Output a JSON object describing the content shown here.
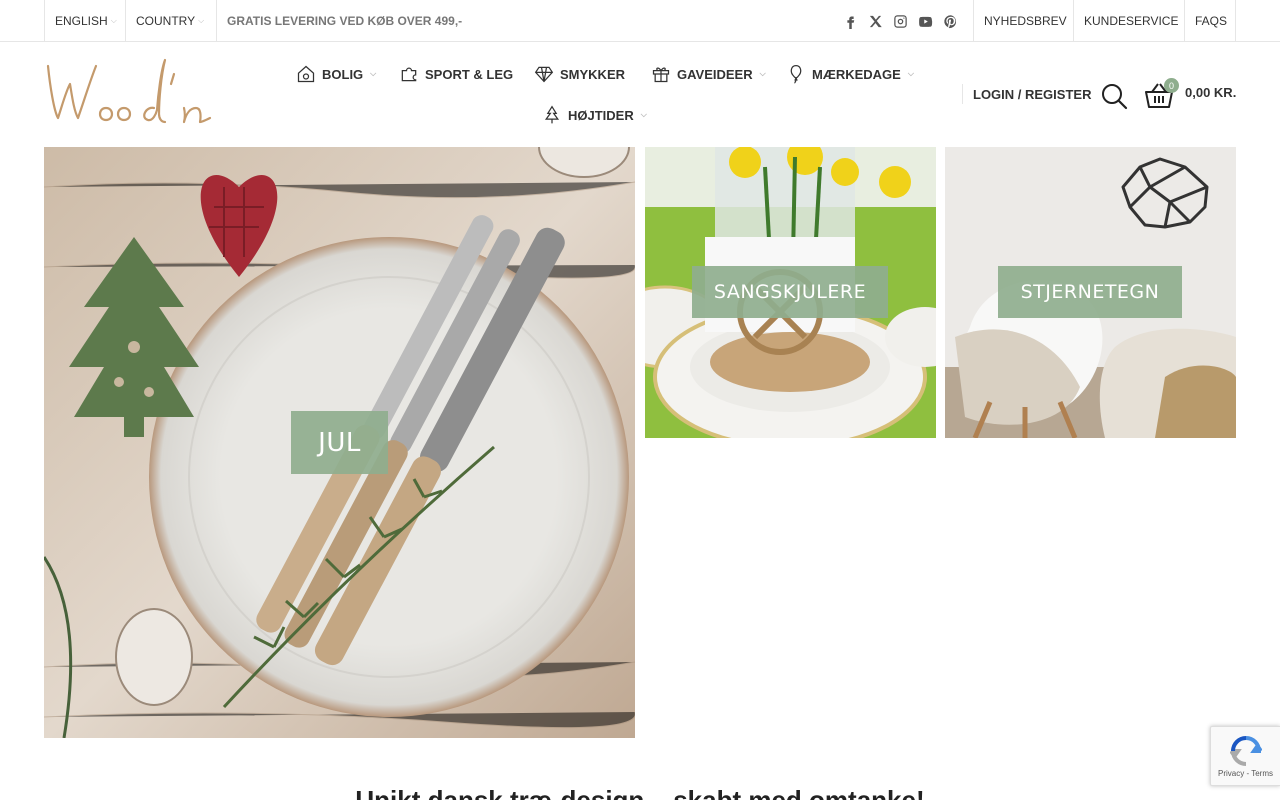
{
  "topbar": {
    "language": "ENGLISH",
    "country": "COUNTRY",
    "promo": "GRATIS LEVERING VED KØB OVER 499,-",
    "social_icons": [
      "facebook-icon",
      "x-icon",
      "instagram-icon",
      "youtube-icon",
      "pinterest-icon"
    ],
    "links": [
      "NYHEDSBREV",
      "KUNDESERVICE",
      "FAQS"
    ]
  },
  "header": {
    "logo_text": "Wood'n",
    "nav": [
      {
        "label": "BOLIG",
        "icon": "house-icon",
        "dropdown": true
      },
      {
        "label": "SPORT & LEG",
        "icon": "puzzle-icon",
        "dropdown": false
      },
      {
        "label": "SMYKKER",
        "icon": "diamond-icon",
        "dropdown": false
      },
      {
        "label": "GAVEIDEER",
        "icon": "gift-icon",
        "dropdown": true
      },
      {
        "label": "MÆRKEDAGE",
        "icon": "balloon-icon",
        "dropdown": true
      },
      {
        "label": "HØJTIDER",
        "icon": "tree-icon",
        "dropdown": true
      }
    ],
    "login": "LOGIN / REGISTER",
    "cart_count": "0",
    "cart_total": "0,00 KR."
  },
  "banners": [
    {
      "label": "JUL"
    },
    {
      "label": "SANGSKJULERE"
    },
    {
      "label": "STJERNETEGN"
    }
  ],
  "headline": "Unikt dansk træ-design – skabt med omtanke!",
  "recaptcha": {
    "links": "Privacy - Terms"
  },
  "colors": {
    "accent": "#8fae8e",
    "logo": "#c49a6c"
  }
}
